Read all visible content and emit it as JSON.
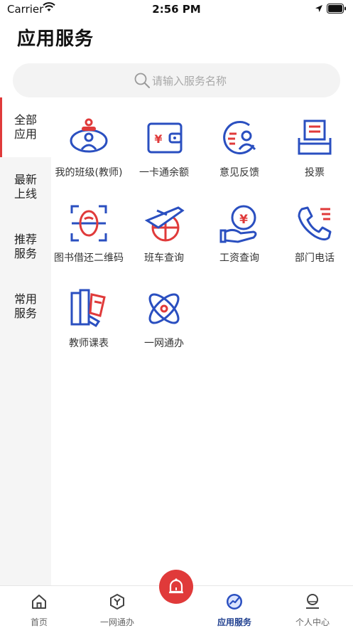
{
  "status_bar": {
    "carrier": "Carrier",
    "time": "2:56 PM"
  },
  "page_title": "应用服务",
  "search": {
    "placeholder": "请输入服务名称"
  },
  "sidebar": {
    "items": [
      {
        "label": "全部应用",
        "active": true
      },
      {
        "label": "最新上线",
        "active": false
      },
      {
        "label": "推荐服务",
        "active": false
      },
      {
        "label": "常用服务",
        "active": false
      }
    ]
  },
  "services": [
    {
      "label": "我的班级(教师)",
      "icon": "class-icon"
    },
    {
      "label": "一卡通余额",
      "icon": "wallet-icon"
    },
    {
      "label": "意见反馈",
      "icon": "feedback-icon"
    },
    {
      "label": "投票",
      "icon": "vote-box-icon"
    },
    {
      "label": "图书借还二维码",
      "icon": "face-scan-icon"
    },
    {
      "label": "班车查询",
      "icon": "airplane-globe-icon"
    },
    {
      "label": "工资查询",
      "icon": "salary-hand-icon"
    },
    {
      "label": "部门电话",
      "icon": "phone-icon"
    },
    {
      "label": "教师课表",
      "icon": "books-icon"
    },
    {
      "label": "一网通办",
      "icon": "orbit-icon"
    }
  ],
  "tab_bar": {
    "items": [
      {
        "label": "首页",
        "icon": "home-icon"
      },
      {
        "label": "一网通办",
        "icon": "hex-y-icon"
      },
      {
        "label": "应用服务",
        "icon": "chart-circle-icon",
        "active": true
      },
      {
        "label": "个人中心",
        "icon": "person-icon"
      }
    ],
    "center_icon": "bell-icon"
  },
  "colors": {
    "accent_red": "#e03a3a",
    "icon_blue": "#2a4fc0",
    "active_tab": "#1f3f8f"
  }
}
